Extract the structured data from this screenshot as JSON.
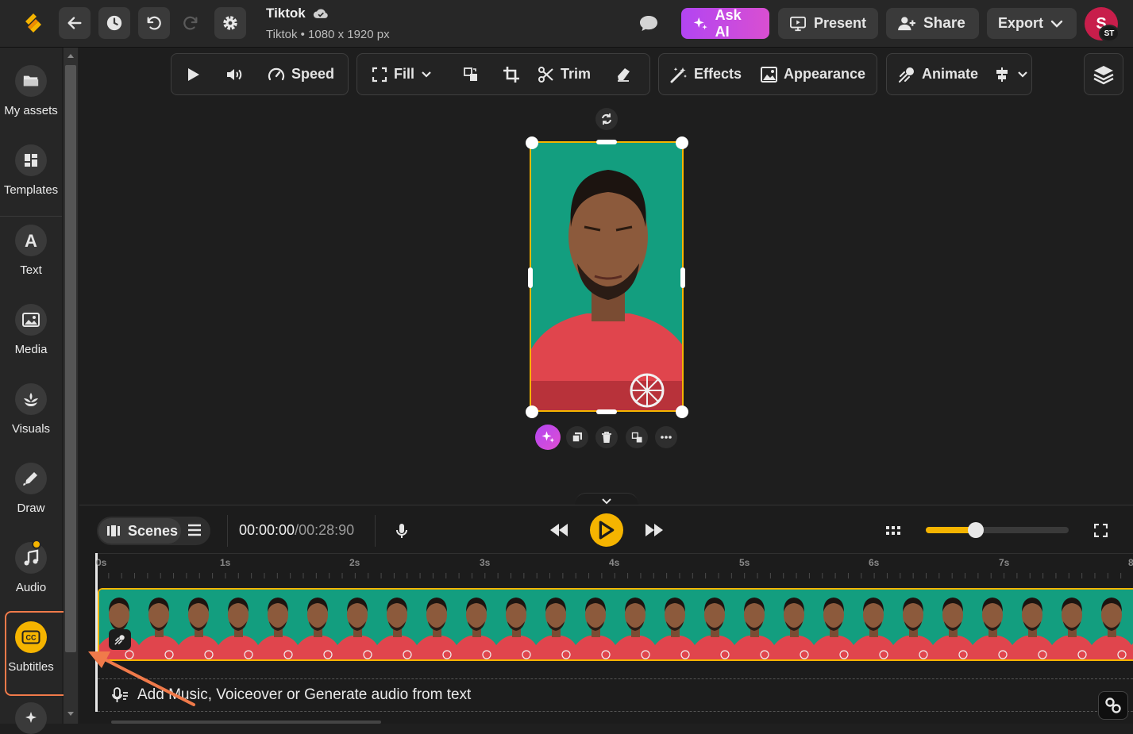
{
  "project": {
    "title": "Tiktok",
    "subtitle": "Tiktok • 1080 x 1920 px"
  },
  "topbar": {
    "ask_ai": "Ask AI",
    "present": "Present",
    "share": "Share",
    "export": "Export",
    "avatar_initial": "S",
    "avatar_badge": "ST"
  },
  "sidebar": {
    "items": [
      {
        "label": "My assets",
        "icon": "folder-icon"
      },
      {
        "label": "Templates",
        "icon": "templates-icon"
      },
      {
        "label": "Text",
        "icon": "text-icon"
      },
      {
        "label": "Media",
        "icon": "image-icon"
      },
      {
        "label": "Visuals",
        "icon": "visuals-icon"
      },
      {
        "label": "Draw",
        "icon": "pen-icon"
      },
      {
        "label": "Audio",
        "icon": "music-icon"
      },
      {
        "label": "Subtitles",
        "icon": "cc-icon"
      }
    ]
  },
  "toolbar": {
    "speed": "Speed",
    "fill": "Fill",
    "trim": "Trim",
    "effects": "Effects",
    "appearance": "Appearance",
    "animate": "Animate"
  },
  "player": {
    "scenes": "Scenes",
    "time_current": "00:00:00",
    "time_total": "/00:28:90",
    "zoom_level": 0.35
  },
  "ruler": {
    "ticks": [
      "0s",
      "1s",
      "2s",
      "3s",
      "4s",
      "5s",
      "6s",
      "7s",
      "8"
    ]
  },
  "audio_track": {
    "placeholder": "Add Music, Voiceover or Generate audio from text"
  },
  "colors": {
    "accent_yellow": "#f5b400",
    "ask_ai": "#b84cf0",
    "highlight_orange": "#f07a4a",
    "video_bg": "#139e7f",
    "shirt": "#e0454d"
  }
}
